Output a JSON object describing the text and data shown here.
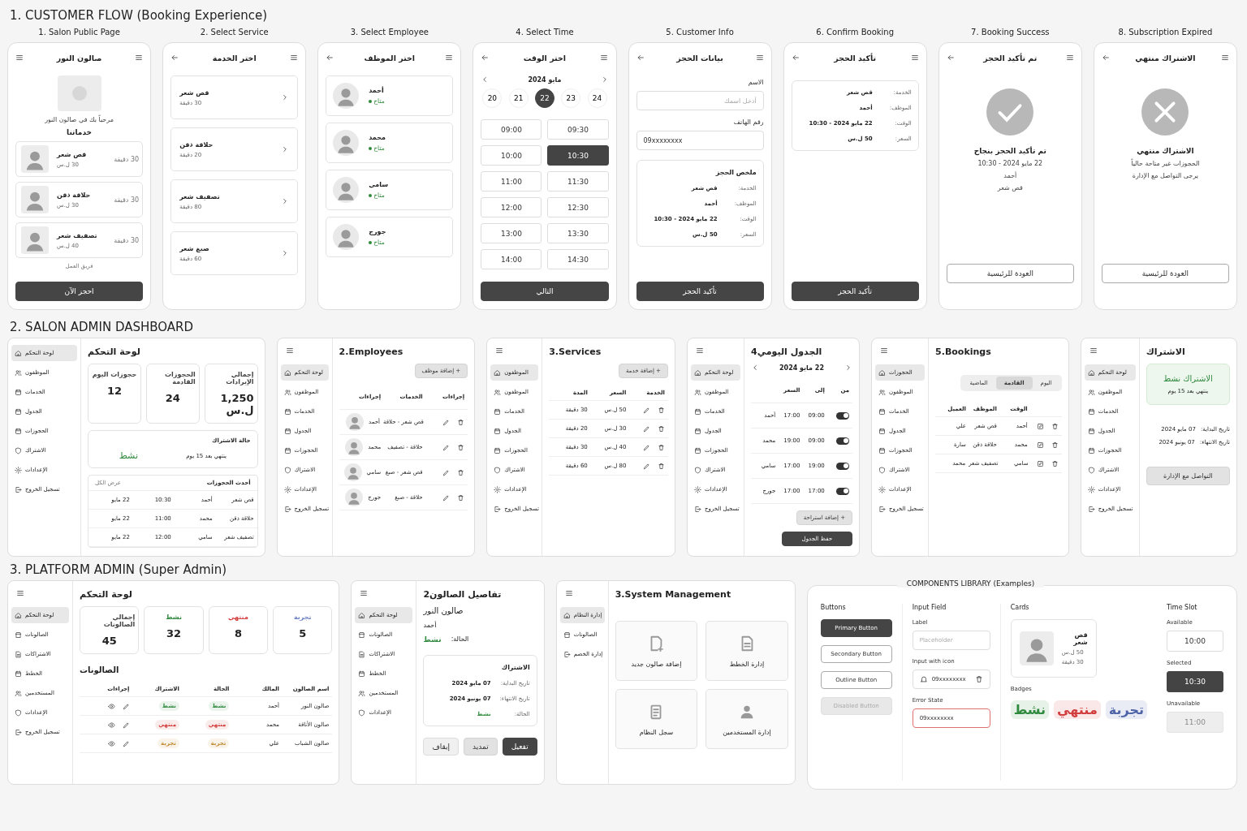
{
  "sections": [
    {
      "kind": "phones",
      "title": "1. CUSTOMER FLOW (Booking Experience)",
      "screens": [
        {
          "caption": "8. Subscription Expired",
          "title": "الاشتراك منتهي",
          "blocks": [
            {
              "kind": "error-icon"
            },
            {
              "kind": "heading",
              "text": "الاشتراك منتهي"
            },
            {
              "kind": "para",
              "text": "الحجوزات غير متاحة حالياً"
            },
            {
              "kind": "para",
              "text": "يرجى التواصل مع الإدارة"
            },
            {
              "kind": "outline-button",
              "label": "العودة للرئيسية"
            }
          ]
        },
        {
          "caption": "7. Booking Success",
          "title": "تم تأكيد الحجز",
          "blocks": [
            {
              "kind": "success-icon"
            },
            {
              "kind": "heading",
              "text": "تم تأكيد الحجز بنجاح"
            },
            {
              "kind": "para",
              "text": "22 مايو 2024 - 10:30"
            },
            {
              "kind": "para",
              "text": "أحمد"
            },
            {
              "kind": "para",
              "text": "قص شعر"
            },
            {
              "kind": "outline-button",
              "label": "العودة للرئيسية"
            }
          ]
        },
        {
          "caption": "6. Confirm Booking",
          "title": "تأكيد الحجز",
          "blocks": [
            {
              "kind": "summary",
              "rows": [
                {
                  "label": "الخدمة:",
                  "value": "قص شعر"
                },
                {
                  "label": "الموظف:",
                  "value": "أحمد"
                },
                {
                  "label": "الوقت:",
                  "value": "22 مايو 2024 - 10:30"
                },
                {
                  "label": "السعر:",
                  "value": "50 ل.س"
                }
              ]
            },
            {
              "kind": "primary-button",
              "label": "تأكيد الحجز"
            }
          ]
        },
        {
          "caption": "5. Customer Info",
          "title": "بيانات الحجز",
          "blocks": [
            {
              "kind": "field",
              "label": "الاسم",
              "placeholder": "أدخل اسمك"
            },
            {
              "kind": "field",
              "label": "رقم الهاتف",
              "value": "09xxxxxxxx"
            },
            {
              "kind": "summary",
              "title": "ملخص الحجز",
              "rows": [
                {
                  "label": "الخدمة:",
                  "value": "قص شعر"
                },
                {
                  "label": "الموظف:",
                  "value": "أحمد"
                },
                {
                  "label": "الوقت:",
                  "value": "22 مايو 2024 - 10:30"
                },
                {
                  "label": "السعر:",
                  "value": "50 ل.س"
                }
              ]
            },
            {
              "kind": "primary-button",
              "label": "تأكيد الحجز"
            }
          ]
        },
        {
          "caption": "4. Select Time",
          "title": "اختر الوقت",
          "blocks": [
            {
              "kind": "month-nav",
              "label": "مايو 2024"
            },
            {
              "kind": "days",
              "items": [
                {
                  "label": "24",
                  "selected": false
                },
                {
                  "label": "23",
                  "selected": false
                },
                {
                  "label": "22",
                  "selected": true
                },
                {
                  "label": "21",
                  "selected": false
                },
                {
                  "label": "20",
                  "selected": false
                }
              ]
            },
            {
              "kind": "slots",
              "items": [
                {
                  "label": "09:30",
                  "selected": false
                },
                {
                  "label": "09:00",
                  "selected": false
                },
                {
                  "label": "10:30",
                  "selected": true
                },
                {
                  "label": "10:00",
                  "selected": false
                },
                {
                  "label": "11:30",
                  "selected": false
                },
                {
                  "label": "11:00",
                  "selected": false
                },
                {
                  "label": "12:30",
                  "selected": false
                },
                {
                  "label": "12:00",
                  "selected": false
                },
                {
                  "label": "13:30",
                  "selected": false
                },
                {
                  "label": "13:00",
                  "selected": false
                },
                {
                  "label": "14:30",
                  "selected": false
                },
                {
                  "label": "14:00",
                  "selected": false
                }
              ]
            },
            {
              "kind": "primary-button",
              "label": "التالي"
            }
          ]
        },
        {
          "caption": "3. Select Employee",
          "title": "اختر الموظف",
          "blocks": [
            {
              "kind": "employee-card",
              "name": "أحمد",
              "status": "متاح"
            },
            {
              "kind": "employee-card",
              "name": "محمد",
              "status": "متاح"
            },
            {
              "kind": "employee-card",
              "name": "سامي",
              "status": "متاح"
            },
            {
              "kind": "employee-card",
              "name": "جورج",
              "status": "متاح"
            }
          ]
        },
        {
          "caption": "2. Select Service",
          "title": "اختر الخدمة",
          "blocks": [
            {
              "kind": "choice-card",
              "name": "قص شعر",
              "duration": "30 دقيقة"
            },
            {
              "kind": "choice-card",
              "name": "حلاقة ذقن",
              "duration": "20 دقيقة"
            },
            {
              "kind": "choice-card",
              "name": "تصفيف شعر",
              "duration": "80 دقيقة"
            },
            {
              "kind": "choice-card",
              "name": "صبغ شعر",
              "duration": "60 دقيقة"
            }
          ]
        },
        {
          "caption": "1. Salon Public Page",
          "title": "صالون النور",
          "blocks": [
            {
              "kind": "logo"
            },
            {
              "kind": "para",
              "text": "مرحباً بك في صالون النور"
            },
            {
              "kind": "heading",
              "text": "خدماتنا"
            },
            {
              "kind": "service-card",
              "name": "قص شعر",
              "price": "30 ل.س",
              "duration": "30 دقيقة"
            },
            {
              "kind": "service-card",
              "name": "حلاقة ذقن",
              "price": "30 ل.س",
              "duration": "30 دقيقة"
            },
            {
              "kind": "service-card",
              "name": "تصفيف شعر",
              "price": "40 ل.س",
              "duration": "30 دقيقة"
            },
            {
              "kind": "note",
              "text": "فريق العمل"
            },
            {
              "kind": "primary-button",
              "label": "احجز الآن"
            }
          ]
        }
      ]
    },
    {
      "kind": "panels",
      "title": "2. SALON ADMIN DASHBOARD",
      "panels": [
        {
          "menu": true,
          "sidebar": [
            {
              "label": "لوحة التحكم",
              "selected": true
            },
            {
              "label": "الموظفون",
              "selected": false
            },
            {
              "label": "الخدمات",
              "selected": false
            },
            {
              "label": "الجدول",
              "selected": false
            },
            {
              "label": "الحجوزات",
              "selected": false
            },
            {
              "label": "الاشتراك",
              "selected": false
            },
            {
              "label": "الإعدادات",
              "selected": false
            },
            {
              "label": "تسجيل الخروج",
              "selected": false
            }
          ],
          "blocks": [
            {
              "kind": "page-title",
              "text": "الاشتراك"
            },
            {
              "kind": "banner",
              "title": "الاشتراك نشط",
              "note": "ينتهي بعد 15 يوم"
            },
            {
              "kind": "info-rows",
              "rows": [
                {
                  "label": "تاريخ البداية:",
                  "value": "07 مايو 2024"
                },
                {
                  "label": "تاريخ الانتهاء:",
                  "value": "07 يونيو 2024"
                }
              ]
            },
            {
              "kind": "secondary-button",
              "label": "التواصل مع الإدارة"
            }
          ]
        },
        {
          "menu": true,
          "sidebar": [
            {
              "label": "الحجوزات",
              "selected": true
            },
            {
              "label": "الموظفون",
              "selected": false
            },
            {
              "label": "الخدمات",
              "selected": false
            },
            {
              "label": "الجدول",
              "selected": false
            },
            {
              "label": "الحجوزات",
              "selected": false
            },
            {
              "label": "الاشتراك",
              "selected": false
            },
            {
              "label": "الإعدادات",
              "selected": false
            },
            {
              "label": "تسجيل الخروج",
              "selected": false
            }
          ],
          "blocks": [
            {
              "kind": "page-title",
              "text": "5.Bookings"
            },
            {
              "kind": "segmented",
              "items": [
                {
                  "label": "اليوم",
                  "selected": false
                },
                {
                  "label": "القادمة",
                  "selected": true
                },
                {
                  "label": "الماضية",
                  "selected": false
                }
              ]
            },
            {
              "kind": "appointments-table",
              "columns": [
                "",
                "الوقت",
                "الموظف",
                "العميل"
              ],
              "rows": [
                {
                  "cells": [
                    "",
                    "أحمد",
                    "قص شعر",
                    "علي"
                  ]
                },
                {
                  "cells": [
                    "",
                    "محمد",
                    "حلاقة ذقن",
                    "سارة"
                  ]
                },
                {
                  "cells": [
                    "",
                    "سامي",
                    "تصفيف شعر",
                    "محمد"
                  ]
                }
              ]
            }
          ]
        },
        {
          "menu": true,
          "sidebar": [
            {
              "label": "لوحة التحكم",
              "selected": true
            },
            {
              "label": "الموظفون",
              "selected": false
            },
            {
              "label": "الخدمات",
              "selected": false
            },
            {
              "label": "الجدول",
              "selected": false
            },
            {
              "label": "الحجوزات",
              "selected": false
            },
            {
              "label": "الاشتراك",
              "selected": false
            },
            {
              "label": "الإعدادات",
              "selected": false
            },
            {
              "label": "تسجيل الخروج",
              "selected": false
            }
          ],
          "blocks": [
            {
              "kind": "page-title",
              "text": "الجدول اليومي4"
            },
            {
              "kind": "date-nav",
              "label": "22 مايو 2024"
            },
            {
              "kind": "schedule-table",
              "columns": [
                "من",
                "إلى",
                "السعر",
                ""
              ],
              "rows": [
                {
                  "on": true,
                  "cells": [
                    "",
                    "09:00",
                    "17:00",
                    "أحمد"
                  ]
                },
                {
                  "on": true,
                  "cells": [
                    "",
                    "09:00",
                    "19:00",
                    "محمد"
                  ]
                },
                {
                  "on": true,
                  "cells": [
                    "",
                    "19:00",
                    "17:00",
                    "سامي"
                  ]
                },
                {
                  "on": true,
                  "cells": [
                    "",
                    "17:00",
                    "17:00",
                    "جورج"
                  ]
                }
              ]
            },
            {
              "kind": "secondary-button",
              "label": "+ إضافة استراحة"
            },
            {
              "kind": "primary-button",
              "label": "حفظ الجدول"
            }
          ]
        },
        {
          "menu": true,
          "sidebar": [
            {
              "label": "الموظفون",
              "selected": true
            },
            {
              "label": "الموظفون",
              "selected": false
            },
            {
              "label": "الخدمات",
              "selected": false
            },
            {
              "label": "الجدول",
              "selected": false
            },
            {
              "label": "الحجوزات",
              "selected": false
            },
            {
              "label": "الاشتراك",
              "selected": false
            },
            {
              "label": "الإعدادات",
              "selected": false
            },
            {
              "label": "تسجيل الخروج",
              "selected": false
            }
          ],
          "blocks": [
            {
              "kind": "page-title",
              "text": "3.Services"
            },
            {
              "kind": "secondary-button",
              "label": "+ إضافة خدمة"
            },
            {
              "kind": "services-table",
              "columns": [
                "الخدمة",
                "السعر",
                "المدة"
              ],
              "rows": [
                {
                  "cells": [
                    "",
                    "50 ل.س",
                    "30 دقيقة"
                  ]
                },
                {
                  "cells": [
                    "",
                    "30 ل.س",
                    "20 دقيقة"
                  ]
                },
                {
                  "cells": [
                    "",
                    "40 ل.س",
                    "30 دقيقة"
                  ]
                },
                {
                  "cells": [
                    "",
                    "80 ل.س",
                    "60 دقيقة"
                  ]
                }
              ]
            }
          ]
        },
        {
          "menu": true,
          "sidebar": [
            {
              "label": "لوحة التحكم",
              "selected": true
            },
            {
              "label": "الموظفون",
              "selected": false
            },
            {
              "label": "الخدمات",
              "selected": false
            },
            {
              "label": "الجدول",
              "selected": false
            },
            {
              "label": "الحجوزات",
              "selected": false
            },
            {
              "label": "الاشتراك",
              "selected": false
            },
            {
              "label": "الإعدادات",
              "selected": false
            },
            {
              "label": "تسجيل الخروج",
              "selected": false
            }
          ],
          "blocks": [
            {
              "kind": "page-title",
              "text": "2.Employees"
            },
            {
              "kind": "secondary-button",
              "label": "+ إضافة موظف"
            },
            {
              "kind": "staff-table",
              "columns": [
                "إجراءات",
                "الخدمات",
                "إجراءات"
              ],
              "rows": [
                {
                  "cells": [
                    "",
                    "قص شعر - حلاقة",
                    "أحمد"
                  ]
                },
                {
                  "cells": [
                    "",
                    "حلاقة - تصفيف",
                    "محمد"
                  ]
                },
                {
                  "cells": [
                    "",
                    "قص شعر - صبغ",
                    "سامي"
                  ]
                },
                {
                  "cells": [
                    "",
                    "حلاقة - صبغ",
                    "جورج"
                  ]
                }
              ]
            }
          ]
        },
        {
          "menu": false,
          "sidebar": [
            {
              "label": "لوحة التحكم",
              "selected": true
            },
            {
              "label": "الموظفون",
              "selected": false
            },
            {
              "label": "الخدمات",
              "selected": false
            },
            {
              "label": "الجدول",
              "selected": false
            },
            {
              "label": "الحجوزات",
              "selected": false
            },
            {
              "label": "الاشتراك",
              "selected": false
            },
            {
              "label": "الإعدادات",
              "selected": false
            },
            {
              "label": "تسجيل الخروج",
              "selected": false
            }
          ],
          "blocks": [
            {
              "kind": "page-title",
              "text": "لوحة التحكم"
            },
            {
              "kind": "stats",
              "items": [
                {
                  "label": "إجمالي الإيرادات",
                  "value": "1,250 ل.س"
                },
                {
                  "label": "الحجوزات القادمة",
                  "value": "24"
                },
                {
                  "label": "حجوزات اليوم",
                  "value": "12"
                }
              ]
            },
            {
              "kind": "sub-card",
              "title": "حالة الاشتراك",
              "note": "ينتهي بعد 15 يوم",
              "status": "نشط"
            },
            {
              "kind": "recent-table",
              "title": "أحدث الحجوزات",
              "link": "عرض الكل",
              "rows": [
                {
                  "cells": [
                    "قص شعر",
                    "أحمد",
                    "10:30",
                    "22 مايو"
                  ]
                },
                {
                  "cells": [
                    "حلاقة ذقن",
                    "محمد",
                    "11:00",
                    "22 مايو"
                  ]
                },
                {
                  "cells": [
                    "تصفيف شعر",
                    "سامي",
                    "12:00",
                    "22 مايو"
                  ]
                }
              ]
            }
          ]
        }
      ]
    },
    {
      "kind": "panels",
      "title": "3. PLATFORM ADMIN (Super Admin)",
      "library": {
        "title": "COMPONENTS LIBRARY (Examples)",
        "columns": [
          {
            "title": "Time Slot",
            "items": [
              {
                "kind": "slot",
                "label": "Available",
                "value": "10:00",
                "selected": false,
                "disabled": false
              },
              {
                "kind": "slot",
                "label": "Selected",
                "value": "10:30",
                "selected": true,
                "disabled": false
              },
              {
                "kind": "slot",
                "label": "Unavailable",
                "value": "11:00",
                "selected": false,
                "disabled": true
              }
            ]
          },
          {
            "title": "Cards",
            "items": [
              {
                "kind": "card",
                "name": "قص شعر",
                "price": "50 ل.س",
                "duration": "30 دقيقة"
              },
              {
                "kind": "label",
                "text": "Badges"
              },
              {
                "kind": "badges",
                "items": [
                  {
                    "text": "تجربة",
                    "color": "#4f64a8"
                  },
                  {
                    "text": "منتهي",
                    "color": "#d23c3c"
                  },
                  {
                    "text": "نشط",
                    "color": "#2f8a3e"
                  }
                ]
              }
            ]
          },
          {
            "title": "Input Field",
            "items": [
              {
                "kind": "field",
                "label": "Label",
                "placeholder": "Placeholder",
                "error": false
              },
              {
                "kind": "icon-field",
                "label": "Input with icon",
                "value": "09xxxxxxxx",
                "error": false
              },
              {
                "kind": "field",
                "label": "Error State",
                "value": "09xxxxxxxx",
                "error": true
              }
            ]
          },
          {
            "title": "Buttons",
            "items": [
              {
                "kind": "primary-button",
                "label": "Primary Button",
                "disabled": false
              },
              {
                "kind": "outline-button",
                "label": "Secondary Button",
                "disabled": false
              },
              {
                "kind": "outline-button",
                "label": "Outline Button",
                "disabled": false
              },
              {
                "kind": "outline-button",
                "label": "Disabled Button",
                "disabled": true
              }
            ]
          }
        ]
      },
      "panels": [
        {
          "menu": true,
          "sidebar": [
            {
              "label": "إدارة النظام",
              "selected": true
            },
            {
              "label": "الصالونات",
              "selected": false
            },
            {
              "label": "إدارة الخصم",
              "selected": false
            }
          ],
          "blocks": [
            {
              "kind": "page-title",
              "text": "3.System Management"
            },
            {
              "kind": "tiles",
              "items": [
                {
                  "label": "إدارة الخطط"
                },
                {
                  "label": "إضافة صالون جديد"
                },
                {
                  "label": "إدارة المستخدمين"
                },
                {
                  "label": "سجل النظام"
                }
              ]
            }
          ]
        },
        {
          "menu": true,
          "sidebar": [
            {
              "label": "لوحة التحكم",
              "selected": true
            },
            {
              "label": "الصالونات",
              "selected": false
            },
            {
              "label": "الاشتراكات",
              "selected": false
            },
            {
              "label": "الخطط",
              "selected": false
            },
            {
              "label": "المستخدمين",
              "selected": false
            },
            {
              "label": "الإعدادات",
              "selected": false
            }
          ],
          "blocks": [
            {
              "kind": "page-title",
              "text": "تفاصيل الصالون2"
            },
            {
              "kind": "detail",
              "name": "صالون النور",
              "owner": "أحمد",
              "status_label": "الحالة:",
              "status": "نشط",
              "color": "#2f8a3e"
            },
            {
              "kind": "summary",
              "title": "الاشتراك",
              "rows": [
                {
                  "label": "تاريخ البداية:",
                  "value": "07 مايو 2024"
                },
                {
                  "label": "تاريخ الانتهاء:",
                  "value": "07 يونيو 2024"
                },
                {
                  "label": "الحالة:",
                  "value": "نشط",
                  "color": "#2f8a3e"
                }
              ]
            },
            {
              "kind": "buttons",
              "items": [
                {
                  "kind": "primary-button",
                  "label": "تفعيل"
                },
                {
                  "kind": "secondary-button",
                  "label": "تمديد"
                },
                {
                  "kind": "light-button",
                  "label": "إيقاف"
                }
              ]
            }
          ]
        },
        {
          "menu": true,
          "sidebar": [
            {
              "label": "لوحة التحكم",
              "selected": true
            },
            {
              "label": "الصالونات",
              "selected": false
            },
            {
              "label": "الاشتراكات",
              "selected": false
            },
            {
              "label": "الخطط",
              "selected": false
            },
            {
              "label": "المستخدمين",
              "selected": false
            },
            {
              "label": "الإعدادات",
              "selected": false
            },
            {
              "label": "تسجيل الخروج",
              "selected": false
            }
          ],
          "blocks": [
            {
              "kind": "page-title",
              "text": "لوحة التحكم"
            },
            {
              "kind": "stats",
              "items": [
                {
                  "label": "تجربة",
                  "value": "5",
                  "color": "#6b80c4"
                },
                {
                  "label": "منتهي",
                  "value": "8",
                  "color": "#d23c3c"
                },
                {
                  "label": "نشط",
                  "value": "32",
                  "color": "#2f8a3e"
                },
                {
                  "label": "إجمالي الصالونات",
                  "value": "45"
                }
              ]
            },
            {
              "kind": "subtitle",
              "text": "الصالونات"
            },
            {
              "kind": "salons-table",
              "columns": [
                "اسم الصالون",
                "المالك",
                "الحالة",
                "الاشتراك",
                "إجراءات"
              ],
              "rows": [
                {
                  "cells": [
                    {
                      "text": "صالون النور"
                    },
                    {
                      "text": "أحمد"
                    },
                    {
                      "text": "نشط",
                      "color": "#2f8a3e"
                    },
                    {
                      "text": "نشط",
                      "color": "#2f8a3e"
                    },
                    {
                      "text": ""
                    }
                  ]
                },
                {
                  "cells": [
                    {
                      "text": "صالون الأناقة"
                    },
                    {
                      "text": "محمد"
                    },
                    {
                      "text": "منتهي",
                      "color": "#d23c3c"
                    },
                    {
                      "text": "منتهي",
                      "color": "#d23c3c"
                    },
                    {
                      "text": ""
                    }
                  ]
                },
                {
                  "cells": [
                    {
                      "text": "صالون الشباب"
                    },
                    {
                      "text": "علي"
                    },
                    {
                      "text": "تجربة",
                      "color": "#c08a2e"
                    },
                    {
                      "text": "تجربة",
                      "color": "#c08a2e"
                    },
                    {
                      "text": ""
                    }
                  ]
                }
              ]
            }
          ]
        }
      ]
    }
  ]
}
